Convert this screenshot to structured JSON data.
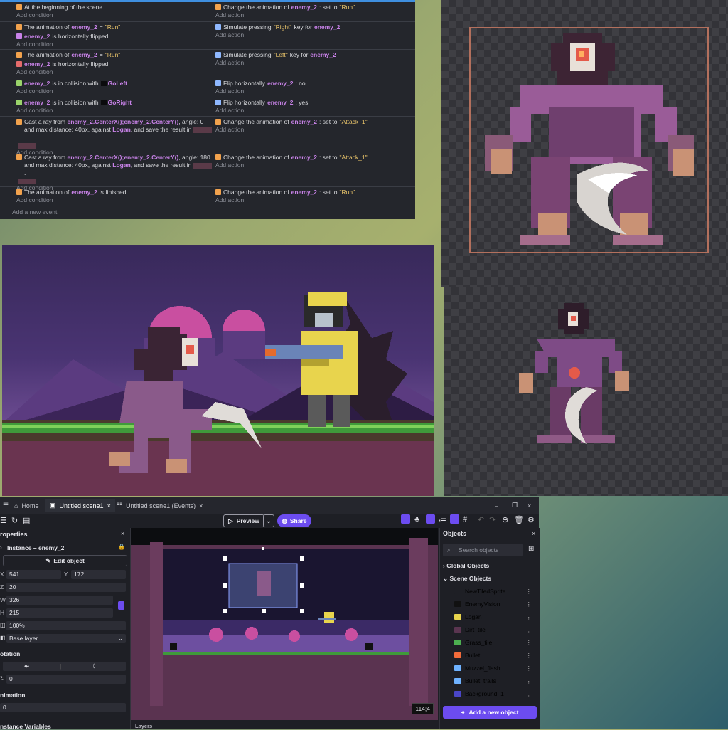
{
  "events": {
    "rows": [
      {
        "cond": [
          {
            "parts": [
              "At the beginning of the scene"
            ]
          }
        ],
        "act": [
          {
            "parts": [
              "Change the animation of",
              "enemy_2",
              ": set to",
              "\"Run\""
            ]
          }
        ]
      },
      {
        "cond": [
          {
            "parts": [
              "The animation of",
              "enemy_2",
              "=",
              "\"Run\""
            ]
          },
          {
            "parts": [
              "enemy_2",
              "is horizontally flipped"
            ]
          }
        ],
        "act": [
          {
            "parts": [
              "Simulate pressing",
              "\"Right\"",
              "key for",
              "enemy_2"
            ]
          }
        ]
      },
      {
        "cond": [
          {
            "parts": [
              "The animation of",
              "enemy_2",
              "=",
              "\"Run\""
            ]
          },
          {
            "parts": [
              "enemy_2",
              "is horizontally flipped"
            ]
          }
        ],
        "act": [
          {
            "parts": [
              "Simulate pressing",
              "\"Left\"",
              "key for",
              "enemy_2"
            ]
          }
        ]
      },
      {
        "cond": [
          {
            "parts": [
              "enemy_2",
              "is in collision with",
              "GoLeft"
            ]
          }
        ],
        "act": [
          {
            "parts": [
              "Flip horizontally",
              "enemy_2",
              ": no"
            ]
          }
        ]
      },
      {
        "cond": [
          {
            "parts": [
              "enemy_2",
              "is in collision with",
              "GoRight"
            ]
          }
        ],
        "act": [
          {
            "parts": [
              "Flip horizontally",
              "enemy_2",
              ": yes"
            ]
          }
        ]
      },
      {
        "cond": [
          {
            "parts": [
              "Cast a ray from",
              "enemy_2.CenterX();enemy_2.CenterY()",
              ", angle: 0 and max distance: 40px, against",
              "Logan",
              ", and save the result in"
            ]
          }
        ],
        "act": [
          {
            "parts": [
              "Change the animation of",
              "enemy_2",
              ": set to",
              "\"Attack_1\""
            ]
          }
        ]
      },
      {
        "cond": [
          {
            "parts": [
              "Cast a ray from",
              "enemy_2.CenterX();enemy_2.CenterY()",
              ", angle: 180 and max distance: 40px, against",
              "Logan",
              ", and save the result in"
            ]
          }
        ],
        "act": [
          {
            "parts": [
              "Change the animation of",
              "enemy_2",
              ": set to",
              "\"Attack_1\""
            ]
          }
        ]
      },
      {
        "cond": [
          {
            "parts": [
              "The animation of",
              "enemy_2",
              "is finished"
            ]
          }
        ],
        "act": [
          {
            "parts": [
              "Change the animation of",
              "enemy_2",
              ": set to",
              "\"Run\""
            ]
          }
        ]
      }
    ],
    "add_condition": "Add condition",
    "add_action": "Add action",
    "add_event": "Add a new event"
  },
  "editor": {
    "tabs": {
      "home": "Home",
      "scene": "Untitled scene1",
      "events": "Untitled scene1 (Events)"
    },
    "toolbar": {
      "preview": "Preview",
      "share": "Share"
    },
    "properties": {
      "title": "roperties",
      "instance_label": "Instance",
      "instance_name": "enemy_2",
      "edit_object": "Edit object",
      "x_label": "X",
      "x": "541",
      "y_label": "Y",
      "y": "172",
      "z_label": "Z",
      "z": "20",
      "w_label": "W",
      "w": "326",
      "h_label": "H",
      "h": "215",
      "opacity": "100%",
      "layer": "Base layer",
      "rotation_title": "otation",
      "rotation_value": "0",
      "animation_title": "nimation",
      "animation_value": "0",
      "variables_title": "nstance Variables"
    },
    "scene": {
      "coords": "114;4",
      "layers_title": "Layers"
    },
    "objects": {
      "title": "Objects",
      "search_placeholder": "Search objects",
      "global": "Global Objects",
      "scene": "Scene Objects",
      "items": [
        "NewTiledSprite",
        "EnemyVision",
        "Logan",
        "Dirt_tile",
        "Grass_tile",
        "Bullet",
        "Muzzel_flash",
        "Bullet_trails",
        "Background_1"
      ],
      "item_colors": [
        "#1e1f25",
        "#111111",
        "#e8d44d",
        "#5a3550",
        "#4caf50",
        "#f26b3a",
        "#6fb2ff",
        "#6fb2ff",
        "#4a46c8"
      ],
      "add_button": "Add a new object"
    }
  },
  "colors": {
    "accent": "#6c4cf0",
    "event_chip": "#c882e8",
    "string": "#e8c36a"
  }
}
